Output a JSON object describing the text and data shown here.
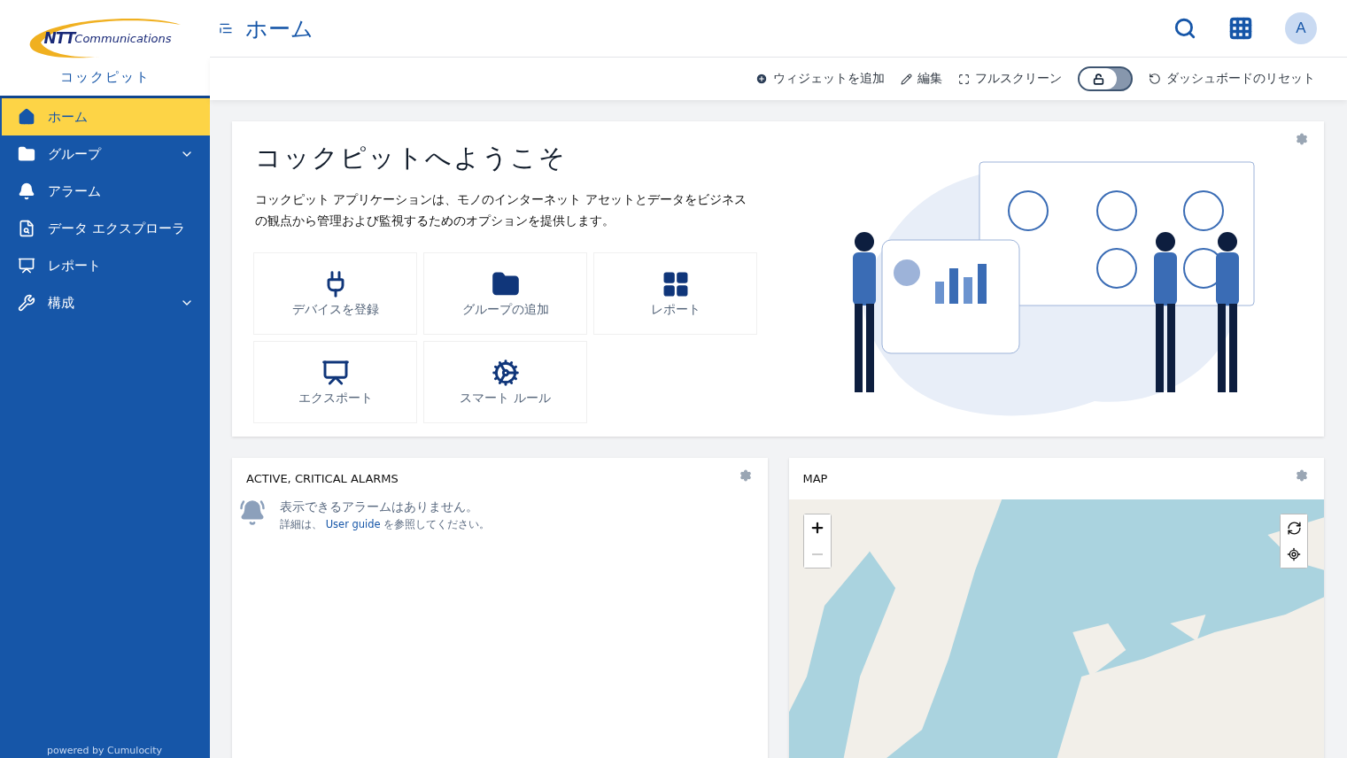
{
  "sidebar": {
    "brand": {
      "logo_mark": "NTT",
      "logo_text": "Communications"
    },
    "app_name": "コックピット",
    "items": [
      {
        "label": "ホーム",
        "selected": true
      },
      {
        "label": "グループ",
        "selected": false,
        "expanded": false
      },
      {
        "label": "アラーム",
        "selected": false
      },
      {
        "label": "データ エクスプローラ",
        "selected": false
      },
      {
        "label": "レポート",
        "selected": false
      },
      {
        "label": "構成",
        "selected": false,
        "expanded": false
      }
    ],
    "footer": "powered by Cumulocity"
  },
  "header": {
    "title": "ホーム",
    "avatar": "A"
  },
  "toolbar": {
    "add_widget": "ウィジェットを追加",
    "edit": "編集",
    "fullscreen": "フルスクリーン",
    "lock_toggle": {
      "on": false
    },
    "reset": "ダッシュボードのリセット"
  },
  "welcome": {
    "title": "コックピットへようこそ",
    "text": "コックピット アプリケーションは、モノのインターネット アセットとデータをビジネスの観点から管理および監視するためのオプションを提供します。",
    "quick_links": [
      {
        "label": "デバイスを登録"
      },
      {
        "label": "グループの追加"
      },
      {
        "label": "レポート"
      },
      {
        "label": "エクスポート"
      },
      {
        "label": "スマート ルール"
      }
    ]
  },
  "alarms_widget": {
    "title": "ACTIVE, CRITICAL ALARMS",
    "empty_message": "表示できるアラームはありません。",
    "hint_before": "詳細は、",
    "hint_link": "User guide",
    "hint_after": "を参照してください。"
  },
  "map_widget": {
    "title": "MAP"
  }
}
